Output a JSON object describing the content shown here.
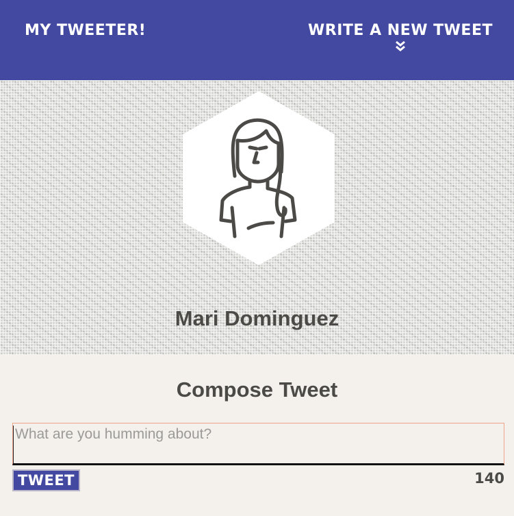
{
  "colors": {
    "nav": "#4349a0",
    "text": "#4b4a47",
    "page_bg": "#f4f1ec",
    "input_border": "#f0a58a"
  },
  "nav": {
    "brand": "MY TWEETER!",
    "compose_toggle": {
      "label": "WRITE A NEW TWEET",
      "icon": "double-chevron-down-icon"
    }
  },
  "profile": {
    "avatar_icon": "female-user-avatar-icon",
    "name": "Mari Dominguez"
  },
  "compose": {
    "title": "Compose Tweet",
    "input": {
      "value": "",
      "placeholder": "What are you humming about?"
    },
    "submit_label": "TWEET",
    "char_counter": "140"
  }
}
